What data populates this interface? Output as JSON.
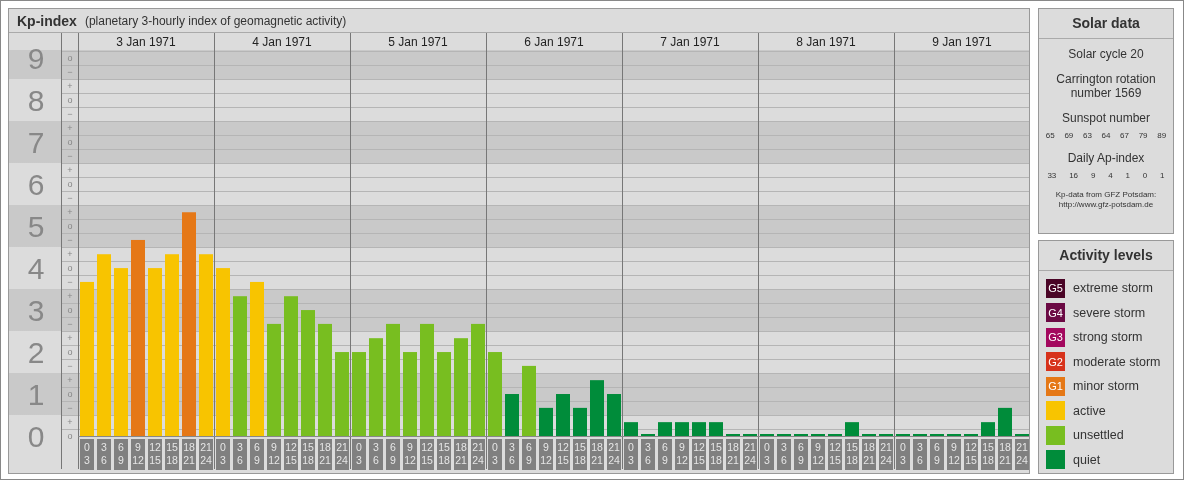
{
  "header": {
    "title": "Kp-index",
    "subtitle": "(planetary 3-hourly index of geomagnetic activity)"
  },
  "kp_chart": {
    "days": [
      "3 Jan 1971",
      "4 Jan 1971",
      "5 Jan 1971",
      "6 Jan 1971",
      "7 Jan 1971",
      "8 Jan 1971",
      "9 Jan 1971"
    ],
    "kp_marks": [
      "o",
      "−",
      "+",
      "o",
      "−",
      "+",
      "o",
      "−",
      "+",
      "o",
      "−",
      "+",
      "o",
      "−",
      "+",
      "o",
      "−",
      "+",
      "o",
      "−",
      "+",
      "o",
      "−",
      "+",
      "o",
      "−",
      "+",
      "o"
    ],
    "chart_data": {
      "type": "bar",
      "ylim": [
        0,
        9.6
      ],
      "grid": true,
      "yticks": [
        0,
        1,
        2,
        3,
        4,
        5,
        6,
        7,
        8,
        9
      ],
      "categories": [
        "0\n3",
        "3\n6",
        "6\n9",
        "9\n12",
        "12\n15",
        "15\n18",
        "18\n21",
        "21\n24",
        "0\n3",
        "3\n6",
        "6\n9",
        "9\n12",
        "12\n15",
        "15\n18",
        "18\n21",
        "21\n24",
        "0\n3",
        "3\n6",
        "6\n9",
        "9\n12",
        "12\n15",
        "15\n18",
        "18\n21",
        "21\n24",
        "0\n3",
        "3\n6",
        "6\n9",
        "9\n12",
        "12\n15",
        "15\n18",
        "18\n21",
        "21\n24",
        "0\n3",
        "3\n6",
        "6\n9",
        "9\n12",
        "12\n15",
        "15\n18",
        "18\n21",
        "21\n24",
        "0\n3",
        "3\n6",
        "6\n9",
        "9\n12",
        "12\n15",
        "15\n18",
        "18\n21",
        "21\n24",
        "0\n3",
        "3\n6",
        "6\n9",
        "9\n12",
        "12\n15",
        "15\n18",
        "18\n21",
        "21\n24"
      ],
      "series": [
        {
          "color": "#e57817",
          "values": [
            null,
            null,
            null,
            4.67,
            null,
            null,
            5.33,
            null,
            null,
            null,
            null,
            null,
            null,
            null,
            null,
            null,
            null,
            null,
            null,
            null,
            null,
            null,
            null,
            null,
            null,
            null,
            null,
            null,
            null,
            null,
            null,
            null,
            null,
            null,
            null,
            null,
            null,
            null,
            null,
            null,
            null,
            null,
            null,
            null,
            null,
            null,
            null,
            null,
            null,
            null,
            null,
            null,
            null,
            null,
            null,
            null
          ]
        },
        {
          "color": "#f8c400",
          "values": [
            3.67,
            4.33,
            4.0,
            null,
            4.0,
            4.33,
            null,
            4.33,
            4.0,
            null,
            3.67,
            null,
            null,
            null,
            null,
            null,
            null,
            null,
            null,
            null,
            null,
            null,
            null,
            null,
            null,
            null,
            null,
            null,
            null,
            null,
            null,
            null,
            null,
            null,
            null,
            null,
            null,
            null,
            null,
            null,
            null,
            null,
            null,
            null,
            null,
            null,
            null,
            null,
            null,
            null,
            null,
            null,
            null,
            null,
            null,
            null
          ]
        },
        {
          "color": "#78be20",
          "values": [
            null,
            null,
            null,
            null,
            null,
            null,
            null,
            null,
            null,
            3.33,
            null,
            2.67,
            3.33,
            3.0,
            2.67,
            2.0,
            2.0,
            2.33,
            2.67,
            2.0,
            2.67,
            2.0,
            2.33,
            2.67,
            2.0,
            null,
            1.67,
            null,
            null,
            null,
            null,
            null,
            null,
            null,
            null,
            null,
            null,
            null,
            null,
            null,
            null,
            null,
            null,
            null,
            null,
            null,
            null,
            null,
            null,
            null,
            null,
            null,
            null,
            null,
            null,
            null
          ]
        },
        {
          "color": "#008c3a",
          "values": [
            null,
            null,
            null,
            null,
            null,
            null,
            null,
            null,
            null,
            null,
            null,
            null,
            null,
            null,
            null,
            null,
            null,
            null,
            null,
            null,
            null,
            null,
            null,
            null,
            null,
            1.0,
            null,
            0.67,
            1.0,
            0.67,
            1.33,
            1.0,
            0.33,
            0,
            0.33,
            0.33,
            0.33,
            0.33,
            0,
            0,
            0,
            0,
            0,
            0,
            0,
            0.33,
            0,
            0,
            0,
            0,
            0,
            0,
            0,
            0.33,
            0.67,
            0
          ]
        }
      ]
    }
  },
  "solar_data": {
    "title": "Solar data",
    "cycle": "Solar cycle 20",
    "carrington": "Carrington rotation number 1569",
    "sunspot_label": "Sunspot number",
    "sunspot_numbers": [
      "65",
      "69",
      "63",
      "64",
      "67",
      "79",
      "89"
    ],
    "ap_label": "Daily Ap-index",
    "ap_values": [
      "33",
      "16",
      "9",
      "4",
      "1",
      "0",
      "1"
    ],
    "source": "Kp-data from GFZ Potsdam:",
    "source_url": "http://www.gfz-potsdam.de"
  },
  "activity_levels": {
    "title": "Activity levels",
    "items": [
      {
        "badge": "G5",
        "label": "extreme storm",
        "color": "#4a0526"
      },
      {
        "badge": "G4",
        "label": "severe storm",
        "color": "#6b0a44"
      },
      {
        "badge": "G3",
        "label": "strong storm",
        "color": "#a3085e"
      },
      {
        "badge": "G2",
        "label": "moderate storm",
        "color": "#d7321b"
      },
      {
        "badge": "G1",
        "label": "minor storm",
        "color": "#e57817"
      },
      {
        "label": "active",
        "color": "#f8c400"
      },
      {
        "label": "unsettled",
        "color": "#78be20"
      },
      {
        "label": "quiet",
        "color": "#008c3a"
      }
    ]
  }
}
